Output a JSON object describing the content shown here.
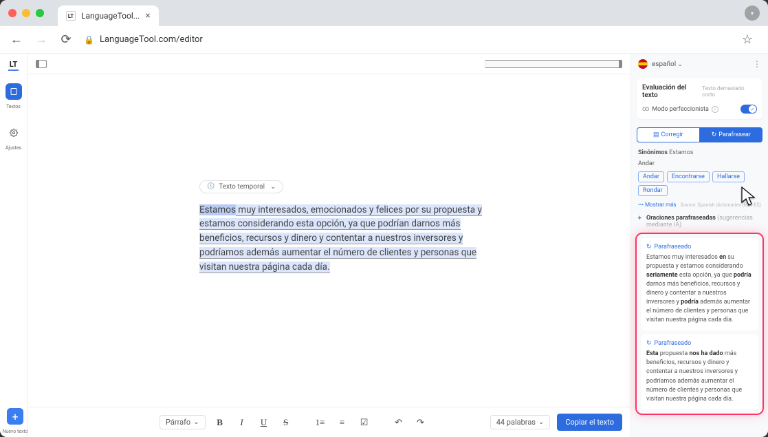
{
  "browser": {
    "tab_title": "LanguageTool...",
    "url_display": "LanguageTool.com/editor"
  },
  "leftrail": {
    "logo": "LT",
    "textos_label": "Textos",
    "ajustes_label": "Ajustes"
  },
  "editor": {
    "temp_chip": "Texto temporal",
    "selected_word": "Estamos",
    "paragraph_rest": " muy interesados, emocionados y felices por su propuesta y estamos considerando esta opción, ya que podrían darnos más beneficios, recursos y dinero y contentar a nuestros inversores y podríamos además aumentar el número de clientes y personas que visitan nuestra página cada día."
  },
  "toolbar": {
    "paragraph_label": "Párrafo",
    "words_label": "44 palabras",
    "copy_label": "Copiar el texto",
    "new_text_label": "Nuevo texto"
  },
  "sidebar": {
    "language": "español",
    "eval_title": "Evaluación del texto",
    "eval_note": "Texto demasiado corto",
    "perf_label": "Modo perfeccionista",
    "btn_correct": "Corregir",
    "btn_paraphrase": "Parafrasear",
    "syn_header_prefix": "Sinónimos ",
    "syn_header_word": "Estamos",
    "syn_group": "Andar",
    "syn_chips": [
      "Andar",
      "Encontrarse",
      "Hallarse",
      "Rondar"
    ],
    "show_more": "Mostrar más",
    "source_label": "Source: Spanish dictionaries (RLA-ES)",
    "oraciones_title": "Oraciones parafraseadas",
    "oraciones_sub": " (sugerencias mediante IA)",
    "card_tag": "Parafraseado",
    "card1_parts": [
      "Estamos muy interesados ",
      "en",
      " su propuesta y estamos considerando ",
      "seriamente",
      " esta opción, ya que ",
      "podría",
      " darnos más beneficios, recursos y dinero y contentar a nuestros inversores y ",
      "podría",
      " además aumentar el número de clientes y personas que visitan nuestra página cada día."
    ],
    "card2_parts": [
      "Esta",
      " propuesta ",
      "nos ha dado",
      " más beneficios, recursos y dinero y contentar a nuestros inversores y podríamos además aumentar el número de clientes y personas que visitan nuestra página cada día."
    ]
  }
}
